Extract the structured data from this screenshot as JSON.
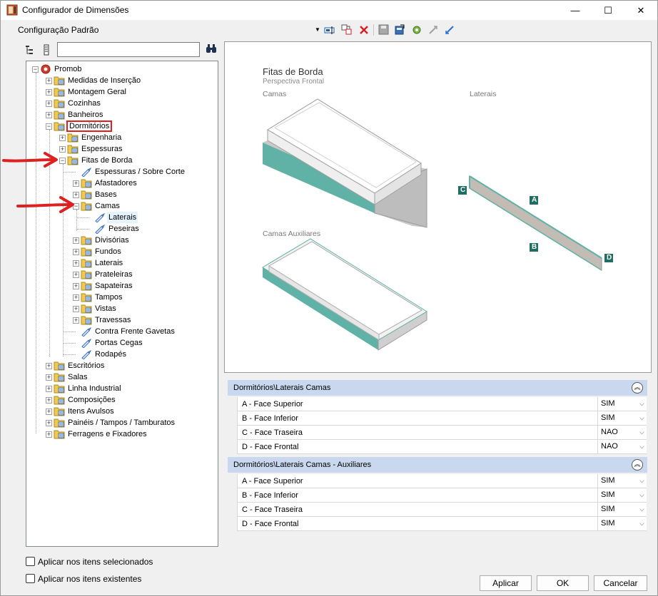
{
  "window": {
    "title": "Configurador de Dimensões",
    "minimize": "—",
    "maximize": "☐",
    "close": "✕"
  },
  "toolbar": {
    "config_value": "Configuração Padrão",
    "dropdown_glyph": "▼"
  },
  "tree": {
    "search_value": "",
    "items": [
      {
        "label": "Promob"
      },
      {
        "label": "Medidas de Inserção"
      },
      {
        "label": "Montagem Geral"
      },
      {
        "label": "Cozinhas"
      },
      {
        "label": "Banheiros"
      },
      {
        "label": "Dormitórios"
      },
      {
        "label": "Engenharia"
      },
      {
        "label": "Espessuras"
      },
      {
        "label": "Fitas de Borda"
      },
      {
        "label": "Espessuras / Sobre Corte"
      },
      {
        "label": "Afastadores"
      },
      {
        "label": "Bases"
      },
      {
        "label": "Camas"
      },
      {
        "label": "Laterais"
      },
      {
        "label": "Peseiras"
      },
      {
        "label": "Divisórias"
      },
      {
        "label": "Fundos"
      },
      {
        "label": "Laterais"
      },
      {
        "label": "Prateleiras"
      },
      {
        "label": "Sapateiras"
      },
      {
        "label": "Tampos"
      },
      {
        "label": "Vistas"
      },
      {
        "label": "Travessas"
      },
      {
        "label": "Contra Frente Gavetas"
      },
      {
        "label": "Portas Cegas"
      },
      {
        "label": "Rodapés"
      },
      {
        "label": "Escritórios"
      },
      {
        "label": "Salas"
      },
      {
        "label": "Linha Industrial"
      },
      {
        "label": "Composições"
      },
      {
        "label": "Itens Avulsos"
      },
      {
        "label": "Painéis / Tampos / Tamburatos"
      },
      {
        "label": "Ferragens e Fixadores"
      }
    ]
  },
  "preview": {
    "title": "Fitas de Borda",
    "subtitle": "Perspectiva Frontal",
    "camas_label": "Camas",
    "laterais_label": "Laterais",
    "camas_aux_label": "Camas Auxiliares",
    "marker_a": "A",
    "marker_b": "B",
    "marker_c": "C",
    "marker_d": "D",
    "accent_color": "#5fb2a5"
  },
  "props": {
    "group1": {
      "title": "Dormitórios\\Laterais Camas",
      "rows": [
        {
          "name": "A - Face Superior",
          "value": "SIM"
        },
        {
          "name": "B - Face Inferior",
          "value": "SIM"
        },
        {
          "name": "C - Face Traseira",
          "value": "NAO"
        },
        {
          "name": "D - Face Frontal",
          "value": "NAO"
        }
      ]
    },
    "group2": {
      "title": "Dormitórios\\Laterais Camas - Auxiliares",
      "rows": [
        {
          "name": "A - Face Superior",
          "value": "SIM"
        },
        {
          "name": "B - Face Inferior",
          "value": "SIM"
        },
        {
          "name": "C - Face Traseira",
          "value": "SIM"
        },
        {
          "name": "D - Face Frontal",
          "value": "SIM"
        }
      ]
    },
    "collapse_glyph": "︽"
  },
  "options": {
    "apply_selected": "Aplicar nos itens selecionados",
    "apply_existing": "Aplicar nos itens existentes"
  },
  "buttons": {
    "apply": "Aplicar",
    "ok": "OK",
    "cancel": "Cancelar"
  }
}
